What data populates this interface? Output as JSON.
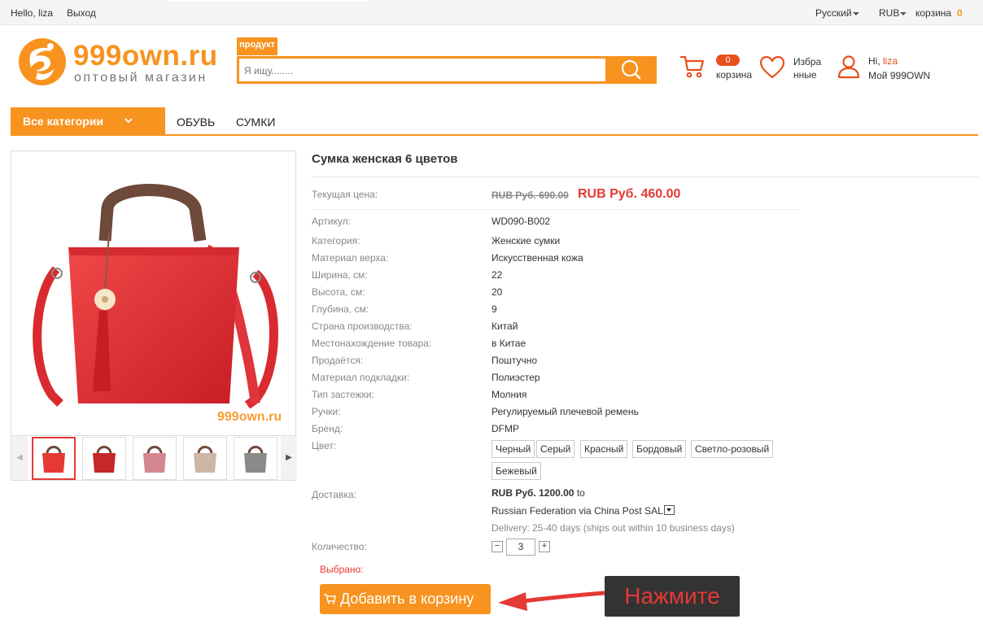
{
  "topbar": {
    "greeting": "Hello, liza",
    "logout": "Выход",
    "language": "Русский",
    "currency": "RUB",
    "cart_label": "корзина",
    "cart_count": "0"
  },
  "logo": {
    "name": "999own.ru",
    "tagline": "оптовый магазин"
  },
  "search": {
    "tab_label": "продукт",
    "placeholder": "Я ищу........"
  },
  "header": {
    "cart_count": "0",
    "cart_label": "корзина",
    "favorites_line1": "Избра",
    "favorites_line2": "нные",
    "hi": "Hi,",
    "username": "liza",
    "my_account": "Мой 999OWN"
  },
  "nav": {
    "all_categories": "Все категории",
    "items": [
      "ОБУВЬ",
      "СУМКИ"
    ]
  },
  "product": {
    "title": "Сумка женская 6 цветов",
    "price_label": "Текущая цена:",
    "old_price": "RUB Руб. 690.00",
    "new_price": "RUB Руб. 460.00",
    "attributes": [
      {
        "label": "Артикул:",
        "value": "WD090-B002"
      },
      {
        "label": "Категория:",
        "value": "Женские сумки"
      },
      {
        "label": "Материал верха:",
        "value": "Искусственная кожа"
      },
      {
        "label": "Ширина, см:",
        "value": "22"
      },
      {
        "label": "Высота, см:",
        "value": "20"
      },
      {
        "label": "Глубина, см:",
        "value": "9"
      },
      {
        "label": "Страна производства:",
        "value": "Китай"
      },
      {
        "label": "Местонахождение товара:",
        "value": "в Китае"
      },
      {
        "label": "Продаётся:",
        "value": "Поштучно"
      },
      {
        "label": "Материал подкладки:",
        "value": "Полиэстер"
      },
      {
        "label": "Тип застежки:",
        "value": "Молния"
      },
      {
        "label": "Ручки:",
        "value": "Регулируемый плечевой ремень"
      },
      {
        "label": "Бренд:",
        "value": "DFMP"
      }
    ],
    "color_label": "Цвет:",
    "colors": [
      "Черный",
      "Серый",
      "Красный",
      "Бордовый",
      "Светло-розовый",
      "Бежевый"
    ],
    "shipping_label": "Доставка:",
    "shipping_price": "RUB Руб. 1200.00",
    "shipping_to": "to",
    "shipping_method": "Russian Federation via China Post SAL",
    "shipping_delivery": "Delivery: 25-40 days (ships out within 10 business days)",
    "quantity_label": "Количество:",
    "quantity": "3",
    "qty_minus": "−",
    "qty_plus": "+",
    "selected_label": "Выбрано:",
    "add_to_cart": "Добавить в корзину",
    "watermark": "999own.ru",
    "thumb_colors": [
      "#e53935",
      "#c62828",
      "#d4878f",
      "#cdb6a6",
      "#8a8a8a"
    ]
  },
  "callout": {
    "text": "Нажмите"
  },
  "colors": {
    "accent": "#f7931e",
    "price": "#e53935",
    "callout_bg": "#333333"
  }
}
